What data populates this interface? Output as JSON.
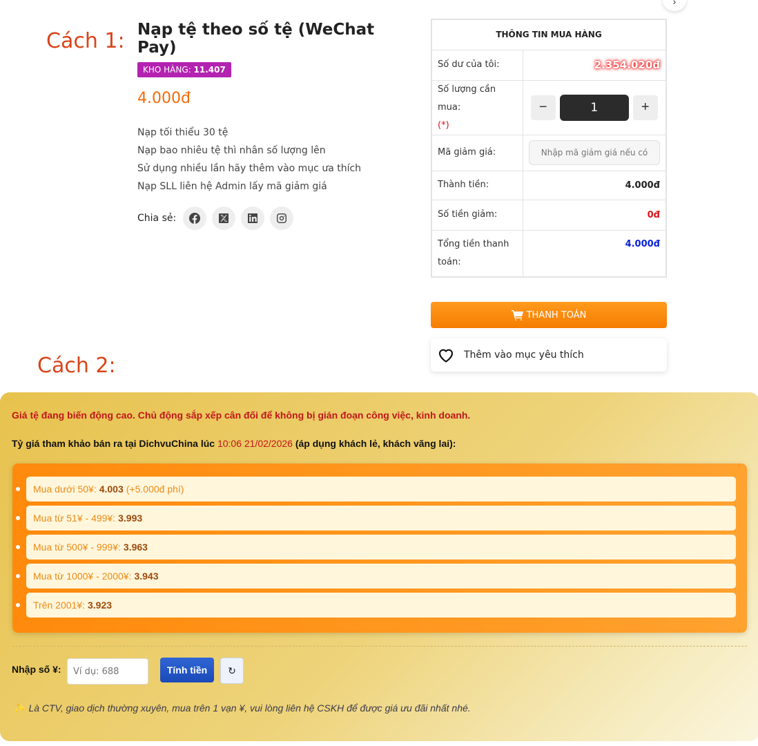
{
  "steps": {
    "step1": "Cách 1:",
    "step2": "Cách 2:"
  },
  "top_bubble_glyph": "›",
  "product": {
    "title": "Nạp tệ theo số tệ (WeChat Pay)",
    "stock_label": "KHO HÀNG:",
    "stock_value": "11.407",
    "price": "4.000đ",
    "description": [
      "Nạp tối thiểu 30 tệ",
      "Nạp bao nhiêu tệ thì nhân số lượng lên",
      "Sử dụng nhiều lần hãy thêm vào mục ưa thích",
      "Nạp SLL liên hệ Admin lấy mã giảm giá"
    ],
    "share_label": "Chia sẻ:",
    "share_icons": [
      "facebook-icon",
      "x-twitter-icon",
      "linkedin-icon",
      "instagram-icon"
    ]
  },
  "order": {
    "title": "THÔNG TIN MUA HÀNG",
    "balance_label": "Số dư của tôi:",
    "balance_value": "2.354.020đ",
    "quantity_label": "Số lượng cần mua:",
    "required_mark": "(*)",
    "quantity_value": "1",
    "minus": "−",
    "plus": "+",
    "discount_label": "Mã giảm giá:",
    "discount_placeholder": "Nhập mã giảm giá nếu có",
    "subtotal_label": "Thành tiền:",
    "subtotal_value": "4.000đ",
    "reduction_label": "Số tiền giảm:",
    "reduction_value": "0đ",
    "total_label": "Tổng tiền thanh toán:",
    "total_value": "4.000đ",
    "pay_label": "THANH TOÁN",
    "wishlist_label": "Thêm vào mục yêu thích"
  },
  "rates": {
    "warning": "Giá tệ đang biến động cao. Chủ động sắp xếp cân đối để không bị gián đoạn công việc, kinh doanh.",
    "note_prefix": "Tỷ giá tham khảo bán ra tại DichvuChina lúc",
    "note_time": "10:06 21/02/2026",
    "note_suffix": "(áp dụng khách lẻ, khách vãng lai):",
    "tiers": [
      {
        "label": "Mua dưới 50¥:",
        "value": "4.003",
        "fee": "(+5.000đ phí)"
      },
      {
        "label": "Mua từ 51¥ - 499¥:",
        "value": "3.993",
        "fee": ""
      },
      {
        "label": "Mua từ 500¥ - 999¥:",
        "value": "3.963",
        "fee": ""
      },
      {
        "label": "Mua từ 1000¥ - 2000¥:",
        "value": "3.943",
        "fee": ""
      },
      {
        "label": "Trên 2001¥:",
        "value": "3.923",
        "fee": ""
      }
    ],
    "calc_label": "Nhập số ¥:",
    "calc_placeholder": "Ví dụ: 688",
    "calc_button": "Tính tiền",
    "reset_glyph": "↻",
    "footnote_icon": "✨",
    "footnote": "Là CTV, giao dịch thường xuyên, mua trên 1 vạn ¥, vui lòng liên hệ CSKH để được giá ưu đãi nhất nhé."
  }
}
